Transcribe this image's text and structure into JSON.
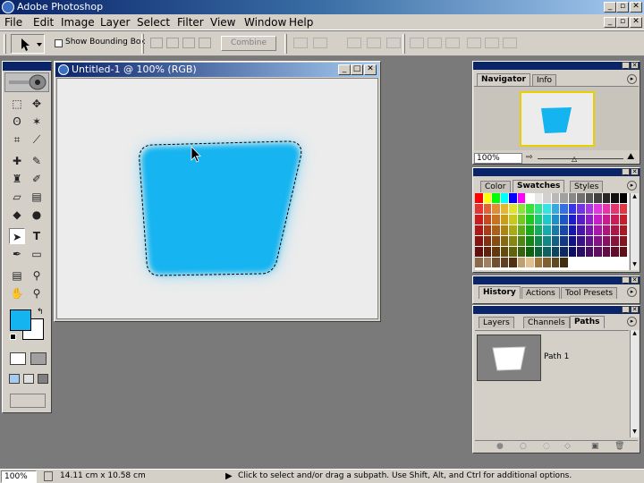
{
  "app": {
    "title": "Adobe Photoshop"
  },
  "menu": [
    "File",
    "Edit",
    "Image",
    "Layer",
    "Select",
    "Filter",
    "View",
    "Window",
    "Help"
  ],
  "options": {
    "show_bounding_box": "Show Bounding Box",
    "combine": "Combine"
  },
  "document": {
    "title": "Untitled-1 @ 100% (RGB)"
  },
  "navigator": {
    "tabs": [
      "Navigator",
      "Info"
    ],
    "zoom": "100%"
  },
  "swatches": {
    "tabs": [
      "Color",
      "Swatches",
      "Styles"
    ]
  },
  "history": {
    "tabs": [
      "History",
      "Actions",
      "Tool Presets"
    ]
  },
  "paths": {
    "tabs": [
      "Layers",
      "Channels",
      "Paths"
    ],
    "items": [
      "Path 1"
    ]
  },
  "status": {
    "zoom": "100%",
    "doc_size": "14.11 cm x 10.58 cm",
    "hint": "Click to select and/or drag a subpath.  Use Shift, Alt, and Ctrl for additional options."
  },
  "colors": {
    "shape_fill": "#14b4f0",
    "foreground": "#14b4f0",
    "background": "#ffffff",
    "titlebar": "#0a246a"
  }
}
